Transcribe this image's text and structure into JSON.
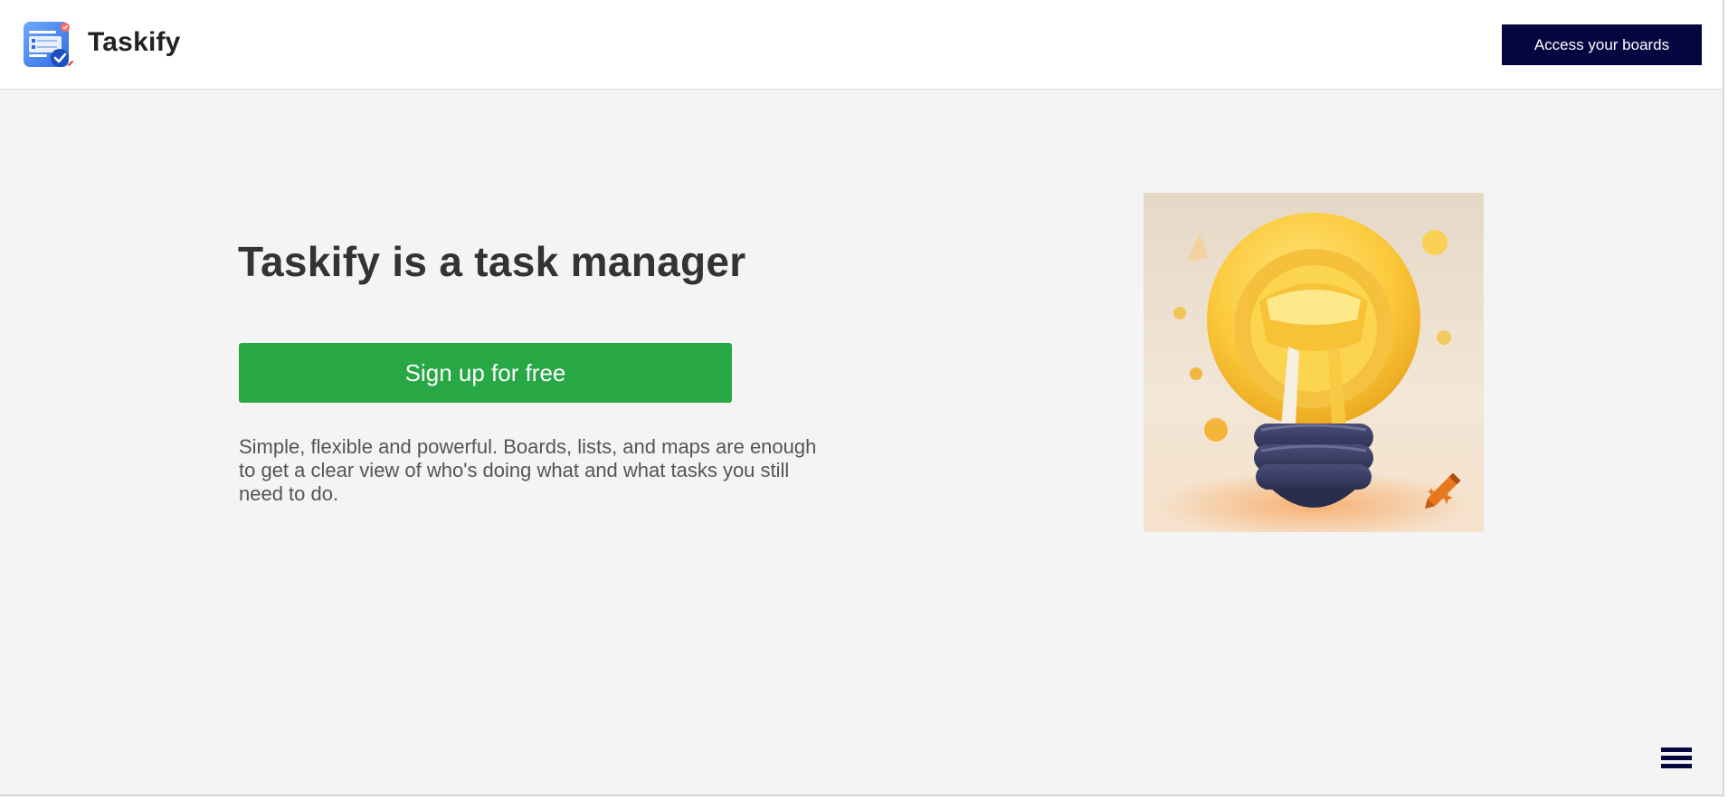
{
  "header": {
    "brand": "Taskify",
    "logo_icon": "task-board-logo-icon",
    "access_label": "Access your boards"
  },
  "hero": {
    "title": "Taskify is a task manager",
    "signup_label": "Sign up for free",
    "description": "Simple, flexible and powerful. Boards, lists, and maps are enough to get a clear view of who's doing what and what tasks you still need to do.",
    "illustration": "lightbulb-illustration"
  },
  "footer": {
    "menu_icon": "hamburger-menu-icon"
  },
  "colors": {
    "access_button_bg": "#050540",
    "signup_button_bg": "#28a745",
    "page_bg": "#f4f4f4",
    "header_bg": "#ffffff"
  }
}
